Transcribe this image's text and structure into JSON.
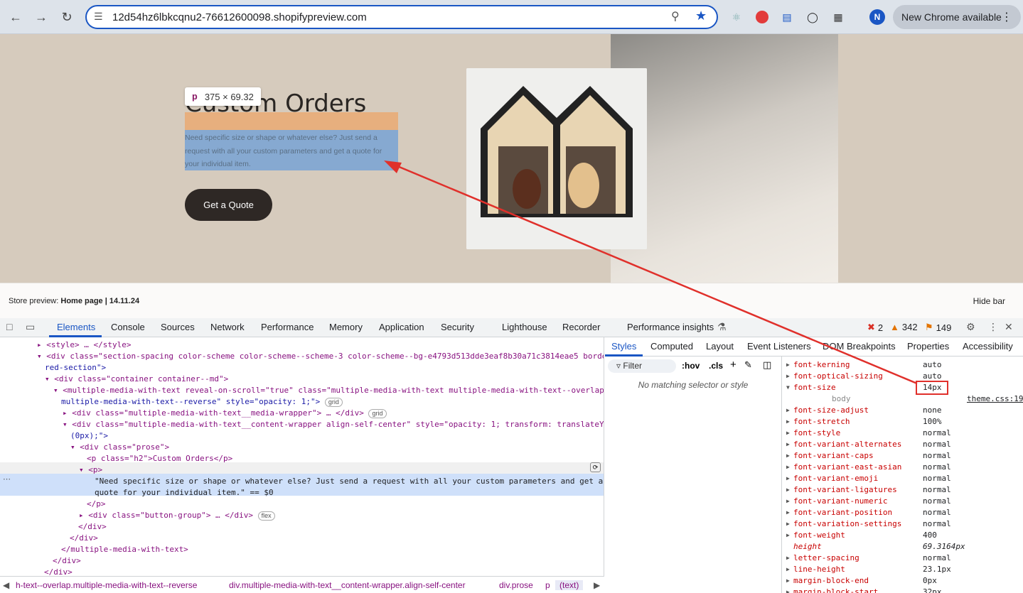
{
  "browser": {
    "url": "12d54hz6lbkcqnu2-76612600098.shopifypreview.com",
    "profile_initial": "N",
    "update_label": "New Chrome available"
  },
  "page": {
    "heading": "Custom Orders",
    "paragraph": "Need specific size or shape or whatever else? Just send a request with all your custom parameters and get a quote for your individual item.",
    "cta_label": "Get a Quote",
    "inspect_tag": "p",
    "inspect_size": "375 × 69.32"
  },
  "store_bar": {
    "prefix": "Store preview: ",
    "page": "Home page | 14.11.24",
    "hide": "Hide bar"
  },
  "devtools": {
    "tabs": [
      "Elements",
      "Console",
      "Sources",
      "Network",
      "Performance",
      "Memory",
      "Application",
      "Security",
      "Lighthouse",
      "Recorder",
      "Performance insights"
    ],
    "errors": "2",
    "warnings": "342",
    "issues": "149",
    "elements": [
      {
        "t": "<style> … </style>"
      },
      {
        "t": "<div class=\"section-spacing color-scheme color-scheme--scheme-3 color-scheme--bg-e4793d513dde3eaf8b30a71c3814eae5 borde"
      },
      {
        "t": "red-section\">"
      },
      {
        "t": "<div class=\"container container--md\">"
      },
      {
        "t": "<multiple-media-with-text reveal-on-scroll=\"true\" class=\"multiple-media-with-text multiple-media-with-text--overlap"
      },
      {
        "t": "multiple-media-with-text--reverse\" style=\"opacity: 1;\">"
      },
      {
        "t": "<div class=\"multiple-media-with-text__media-wrapper\"> … </div>"
      },
      {
        "t": "<div class=\"multiple-media-with-text__content-wrapper align-self-center\" style=\"opacity: 1; transform: translateY"
      },
      {
        "t": "(0px);\">"
      },
      {
        "t": "<div class=\"prose\">"
      },
      {
        "t": "<p class=\"h2\">Custom Orders</p>"
      },
      {
        "t": "<p>"
      },
      {
        "t": "\"Need specific size or shape or whatever else? Just send a request with all your custom parameters and get a"
      },
      {
        "t": "quote for your individual item.\" == $0"
      },
      {
        "t": "</p>"
      },
      {
        "t": "<div class=\"button-group\"> … </div>"
      },
      {
        "t": "</div>"
      },
      {
        "t": "</div>"
      },
      {
        "t": "</multiple-media-with-text>"
      },
      {
        "t": "</div>"
      },
      {
        "t": "</div>"
      }
    ],
    "pills": {
      "grid": "grid",
      "flex": "flex"
    },
    "breadcrumbs": [
      "h-text--overlap.multiple-media-with-text--reverse",
      "div.multiple-media-with-text__content-wrapper.align-self-center",
      "div.prose",
      "p",
      "(text)"
    ],
    "styles_tabs": [
      "Styles",
      "Computed",
      "Layout",
      "Event Listeners",
      "DOM Breakpoints",
      "Properties",
      "Accessibility"
    ],
    "filter_placeholder": "Filter",
    "hov": ":hov",
    "cls": ".cls",
    "no_match": "No matching selector or style",
    "computed": [
      {
        "p": "font-kerning",
        "v": "auto"
      },
      {
        "p": "font-optical-sizing",
        "v": "auto"
      },
      {
        "p": "font-size",
        "v": "14px"
      },
      {
        "p": "body",
        "v": "theme.css:19"
      },
      {
        "p": "font-size-adjust",
        "v": "none"
      },
      {
        "p": "font-stretch",
        "v": "100%"
      },
      {
        "p": "font-style",
        "v": "normal"
      },
      {
        "p": "font-variant-alternates",
        "v": "normal"
      },
      {
        "p": "font-variant-caps",
        "v": "normal"
      },
      {
        "p": "font-variant-east-asian",
        "v": "normal"
      },
      {
        "p": "font-variant-emoji",
        "v": "normal"
      },
      {
        "p": "font-variant-ligatures",
        "v": "normal"
      },
      {
        "p": "font-variant-numeric",
        "v": "normal"
      },
      {
        "p": "font-variant-position",
        "v": "normal"
      },
      {
        "p": "font-variation-settings",
        "v": "normal"
      },
      {
        "p": "font-weight",
        "v": "400"
      },
      {
        "p": "height",
        "v": "69.3164px"
      },
      {
        "p": "letter-spacing",
        "v": "normal"
      },
      {
        "p": "line-height",
        "v": "23.1px"
      },
      {
        "p": "margin-block-end",
        "v": "0px"
      },
      {
        "p": "margin-block-start",
        "v": "32px"
      }
    ]
  },
  "colors": {
    "accent": "#1a56c4",
    "annotation": "#e0302b",
    "cta": "#2e2825",
    "hero_bg": "#d6cbbd"
  }
}
